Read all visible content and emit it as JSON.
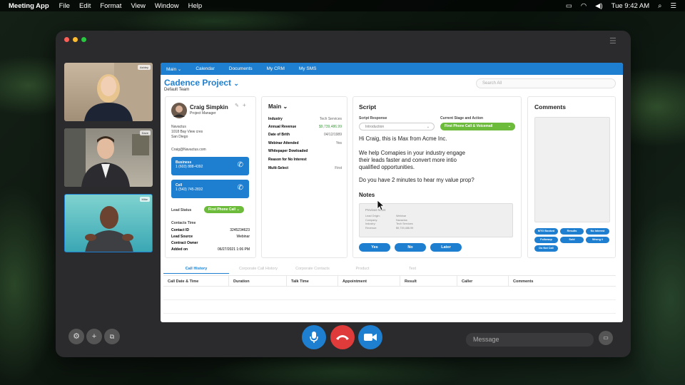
{
  "menubar": {
    "app": "Meeting App",
    "items": [
      "File",
      "Edit",
      "Format",
      "View",
      "Window",
      "Help"
    ],
    "clock": "Tue 9:42 AM"
  },
  "participants": [
    "Ashley",
    "Dave",
    "Mike"
  ],
  "crm": {
    "nav": [
      "Main",
      "Calendar",
      "Documents",
      "My CRM",
      "My SMS"
    ],
    "project_title": "Cadence Project",
    "team": "Default Team",
    "search_placeholder": "Search All"
  },
  "contact": {
    "name": "Craig Simpkin",
    "title": "Project Manager",
    "company": "Navactus",
    "address": "1018 Bay View cres",
    "city": "San Diego",
    "email": "Craig@Navactus.com",
    "business_label": "Business",
    "business_phone": "1 (603) 888-4392",
    "cell_label": "Cell",
    "cell_phone": "1 (543) 745-2832",
    "lead_status_label": "Lead Status",
    "lead_status": "First Phone Call",
    "contacts_time_label": "Contacts Time",
    "contact_id_label": "Contact ID",
    "contact_id": "3245234623",
    "lead_source_label": "Lead Source",
    "lead_source": "Webinar",
    "contract_owner_label": "Contract Owner",
    "added_on_label": "Added on",
    "added_on": "06/27/2021 1:06 PM"
  },
  "mainpanel": {
    "title": "Main",
    "rows": [
      {
        "label": "Industry",
        "value": "Tech Services"
      },
      {
        "label": "Annual Revenue",
        "value": "$9,739,486.99"
      },
      {
        "label": "Date of Brith",
        "value": "04/12/1989"
      },
      {
        "label": "Webinar Attended",
        "value": "Yes"
      },
      {
        "label": "Whitepaper Dowloaded",
        "value": ""
      },
      {
        "label": "Reason for No Interest",
        "value": ""
      },
      {
        "label": "Multi-Select",
        "value": "First"
      }
    ]
  },
  "script": {
    "title": "Script",
    "response_label": "Script Response",
    "response_value": "Introduction",
    "stage_label": "Current Stage and Action",
    "stage_value": "First Phone Call & Voicemail",
    "lines": [
      "Hi Craig, this is Max from Acme Inc.",
      "We help Comapies in your industry engage",
      "their leads faster and convert more intio",
      "qualified opportunities.",
      "Do you have 2 minutes to hear my value prop?"
    ],
    "notes_title": "Notes",
    "notes": {
      "preview": "Previous Notes",
      "labels": [
        "Lead Origin:",
        "Company:",
        "Industry:",
        "Revenue:"
      ],
      "values": [
        "Webinar",
        "Navactus",
        "Tech Services",
        "$9,739,486.99"
      ]
    },
    "buttons": [
      "Yes",
      "No",
      "Later"
    ]
  },
  "comments": {
    "title": "Comments",
    "tags": [
      "MTG Booked",
      "Results",
      "No Interest",
      "Followup",
      "Sold",
      "Wrong #",
      "Do Not Call"
    ]
  },
  "history": {
    "tabs": [
      "Call History",
      "Corporate Call History",
      "Corporate Contacts",
      "Product",
      "Text"
    ],
    "columns": [
      "Call Date & Time",
      "Duration",
      "Talk Time",
      "Appointment",
      "Result",
      "Caller",
      "Comments"
    ]
  },
  "controls": {
    "message_placeholder": "Message"
  },
  "colors": {
    "accent_blue": "#1e7fd0",
    "status_green": "#6dbb3a",
    "end_call_red": "#e03b3b"
  }
}
